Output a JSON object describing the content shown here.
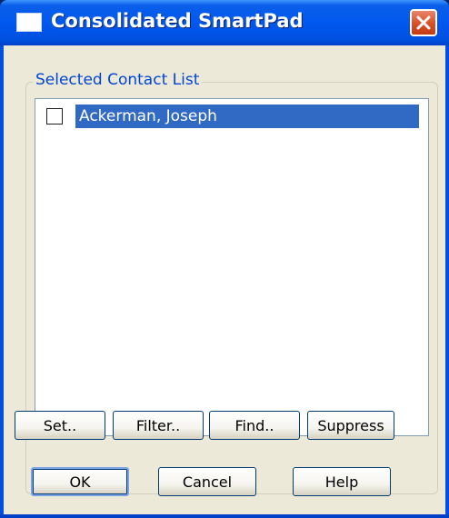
{
  "window": {
    "title": "Consolidated SmartPad"
  },
  "group": {
    "label": "Selected Contact List"
  },
  "contacts": [
    {
      "name": "Ackerman, Joseph",
      "checked": false,
      "selected": true
    }
  ],
  "list_buttons": {
    "set": "Set..",
    "filter": "Filter..",
    "find": "Find..",
    "suppress": "Suppress"
  },
  "dialog_buttons": {
    "ok": "OK",
    "cancel": "Cancel",
    "help": "Help"
  },
  "colors": {
    "titlebar": "#0058ee",
    "selection": "#316ac5",
    "group_label": "#0046d5",
    "dialog_bg": "#ece9d8"
  }
}
